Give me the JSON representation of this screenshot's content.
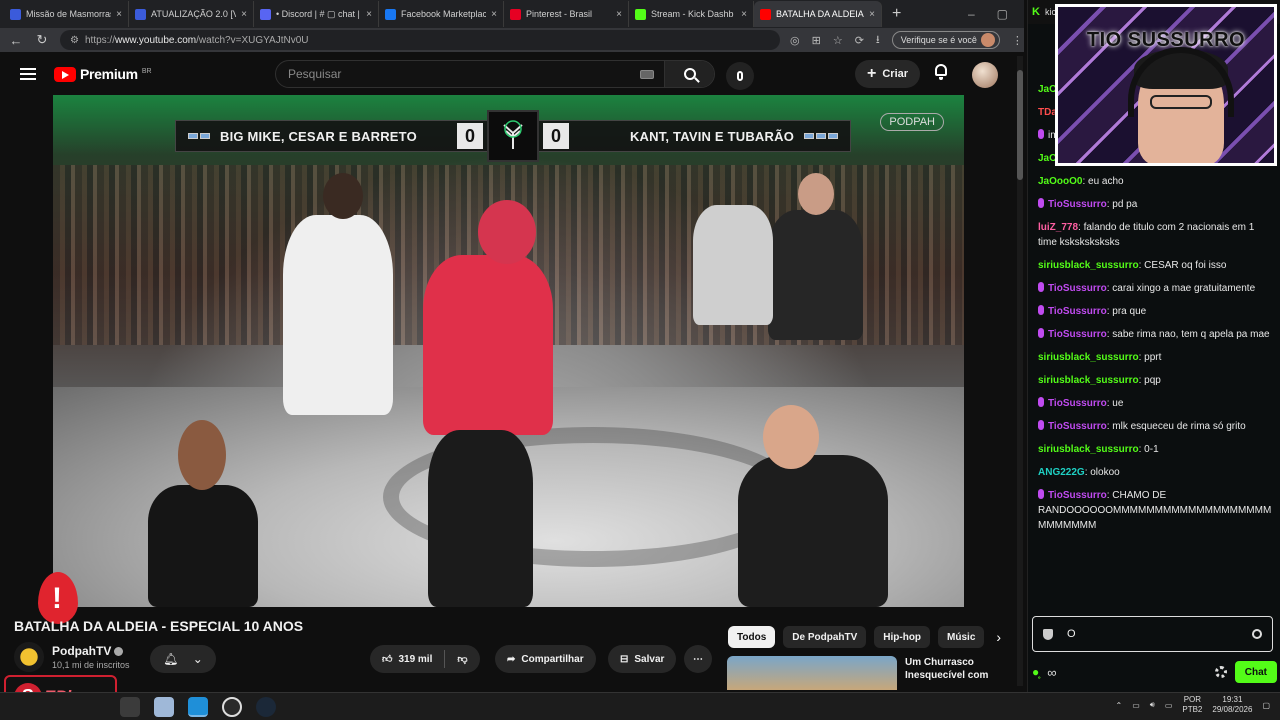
{
  "browser": {
    "tabs": [
      {
        "label": "Missão de Masmorras R",
        "favicon_color": "#3b5bdb",
        "active": false
      },
      {
        "label": "ATUALIZAÇÃO 2.0 [VERÃ",
        "favicon_color": "#3b5bdb",
        "active": false
      },
      {
        "label": "• Discord | # ▢ chat | S",
        "favicon_color": "#5865f2",
        "active": false
      },
      {
        "label": "Facebook Marketplace |",
        "favicon_color": "#1877f2",
        "active": false
      },
      {
        "label": "Pinterest - Brasil",
        "favicon_color": "#e60023",
        "active": false
      },
      {
        "label": "Stream - Kick Dashb",
        "favicon_color": "#53fc18",
        "active": false
      },
      {
        "label": "BATALHA DA ALDEIA",
        "favicon_color": "#ff0000",
        "active": true
      }
    ],
    "url_prefix": "https://",
    "url_host": "www.youtube.com",
    "url_path": "/watch?v=XUGYAJtNv0U",
    "verify_label": "Verifique se é você"
  },
  "youtube": {
    "logo_text": "Premium",
    "logo_region": "BR",
    "search_placeholder": "Pesquisar",
    "create_label": "Criar",
    "video": {
      "title": "BATALHA DA ALDEIA - ESPECIAL 10 ANOS",
      "scoreboard": {
        "left_team": "BIG MIKE, CESAR E BARRETO",
        "left_score": "0",
        "right_score": "0",
        "right_team": "KANT, TAVIN E TUBARÃO",
        "watermark": "PODPAH"
      }
    },
    "channel": {
      "name": "PodpahTV",
      "subscribers": "10,1 mi de inscritos"
    },
    "actions": {
      "likes": "319 mil",
      "share": "Compartilhar",
      "save": "Salvar",
      "more": "⋯"
    },
    "chips": [
      "Todos",
      "De PodpahTV",
      "Hip-hop",
      "Músic"
    ],
    "recommended": {
      "title": "Um Churrasco Inesquecível com"
    }
  },
  "overlays": {
    "brand_s": "S",
    "brand_text": "EPhone"
  },
  "chat": {
    "top_tab": "kic",
    "webcam_title": "TIO SUSSURRO",
    "messages": [
      {
        "user": "JaO",
        "color": "#53fc18",
        "mic": false,
        "text": ""
      },
      {
        "user": "TDa",
        "color": "#ff4d4d",
        "mic": false,
        "text": ""
      },
      {
        "user": "",
        "color": "#c04bf0",
        "mic": true,
        "text": "imp"
      },
      {
        "user": "JaOooO0",
        "color": "#53fc18",
        "mic": false,
        "text": "sim"
      },
      {
        "user": "JaOooO0",
        "color": "#53fc18",
        "mic": false,
        "text": "eu acho"
      },
      {
        "user": "TioSussurro",
        "color": "#c04bf0",
        "mic": true,
        "text": "pd pa"
      },
      {
        "user": "luiZ_778",
        "color": "#ff5fa2",
        "mic": false,
        "text": "falando de titulo com 2 nacionais em 1 time ksksksksksks"
      },
      {
        "user": "siriusblack_sussurro",
        "color": "#53fc18",
        "mic": false,
        "text": "CESAR oq foi isso"
      },
      {
        "user": "TioSussurro",
        "color": "#c04bf0",
        "mic": true,
        "text": "carai xingo a mae gratuitamente"
      },
      {
        "user": "TioSussurro",
        "color": "#c04bf0",
        "mic": true,
        "text": "pra que"
      },
      {
        "user": "TioSussurro",
        "color": "#c04bf0",
        "mic": true,
        "text": "sabe rima nao, tem q apela pa mae"
      },
      {
        "user": "siriusblack_sussurro",
        "color": "#53fc18",
        "mic": false,
        "text": "pprt"
      },
      {
        "user": "siriusblack_sussurro",
        "color": "#53fc18",
        "mic": false,
        "text": "pqp"
      },
      {
        "user": "TioSussurro",
        "color": "#c04bf0",
        "mic": true,
        "text": "ue"
      },
      {
        "user": "TioSussurro",
        "color": "#c04bf0",
        "mic": true,
        "text": "mlk esqueceu de rima só grito"
      },
      {
        "user": "siriusblack_sussurro",
        "color": "#53fc18",
        "mic": false,
        "text": "0-1"
      },
      {
        "user": "ANG222G",
        "color": "#1fd1c4",
        "mic": false,
        "text": "olokoo"
      },
      {
        "user": "TioSussurro",
        "color": "#c04bf0",
        "mic": true,
        "text": "CHAMO DE RANDOOOOOOMMMMMMMMMMMMMMMMMMMMMMMMMM"
      }
    ],
    "input_value": "O",
    "chat_button": "Chat"
  },
  "taskbar": {
    "lang_top": "POR",
    "lang_bottom": "PTB2",
    "time": "19:31",
    "date": "29/08/2026"
  },
  "colors": {
    "kick_green": "#53fc18",
    "youtube_red": "#ff0000"
  }
}
